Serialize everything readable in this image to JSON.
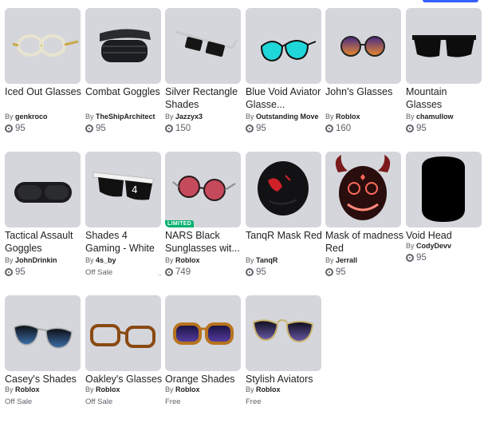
{
  "items": [
    {
      "name": "Iced Out Glasses",
      "by": "By",
      "creator": "genkroco",
      "price": "95",
      "icon": "iced-out-glasses-icon"
    },
    {
      "name": "Combat Goggles",
      "by": "By",
      "creator": "TheShipArchitect",
      "price": "95",
      "icon": "combat-goggles-icon"
    },
    {
      "name": "Silver Rectangle Shades",
      "by": "By",
      "creator": "Jazzyx3",
      "price": "150",
      "icon": "silver-rectangle-shades-icon"
    },
    {
      "name": "Blue Void Aviator Glasse...",
      "by": "By",
      "creator": "Outstanding Move",
      "price": "95",
      "icon": "blue-void-aviator-icon"
    },
    {
      "name": "John's Glasses",
      "by": "By",
      "creator": "Roblox",
      "price": "160",
      "icon": "johns-glasses-icon"
    },
    {
      "name": "Mountain Glasses",
      "by": "By",
      "creator": "chamullow",
      "price": "95",
      "icon": "mountain-glasses-icon"
    },
    {
      "name": "Tactical Assault Goggles",
      "by": "By",
      "creator": "JohnDrinkin",
      "price": "95",
      "icon": "tactical-goggles-icon"
    },
    {
      "name": "Shades 4 Gaming - White",
      "by": "By",
      "creator": "4s_by",
      "price": "Off Sale",
      "icon": "shades-4-gaming-icon"
    },
    {
      "name": "NARS Black Sunglasses wit...",
      "by": "By",
      "creator": "Roblox",
      "price": "749",
      "badge": "LIMITED",
      "icon": "nars-sunglasses-icon"
    },
    {
      "name": "TanqR Mask Red",
      "by": "By",
      "creator": "TanqR",
      "price": "95",
      "icon": "tanqr-mask-icon"
    },
    {
      "name": "Mask of madness Red",
      "by": "By",
      "creator": "Jerrall",
      "price": "95",
      "icon": "mask-of-madness-icon"
    },
    {
      "name": "Void Head",
      "by": "By",
      "creator": "CodyDevv",
      "price": "95",
      "icon": "void-head-icon"
    },
    {
      "name": "Casey's Shades",
      "by": "By",
      "creator": "Roblox",
      "price": "Off Sale",
      "icon": "caseys-shades-icon"
    },
    {
      "name": "Oakley's Glasses",
      "by": "By",
      "creator": "Roblox",
      "price": "Off Sale",
      "icon": "oakleys-glasses-icon"
    },
    {
      "name": "Orange Shades",
      "by": "By",
      "creator": "Roblox",
      "price": "Free",
      "icon": "orange-shades-icon"
    },
    {
      "name": "Stylish Aviators",
      "by": "By",
      "creator": "Roblox",
      "price": "Free",
      "icon": "stylish-aviators-icon"
    }
  ],
  "ellipsis": "..",
  "colors": {
    "thumb_bg": "#d4d6db",
    "limited": "#00b06f",
    "accent": "#335fff"
  }
}
